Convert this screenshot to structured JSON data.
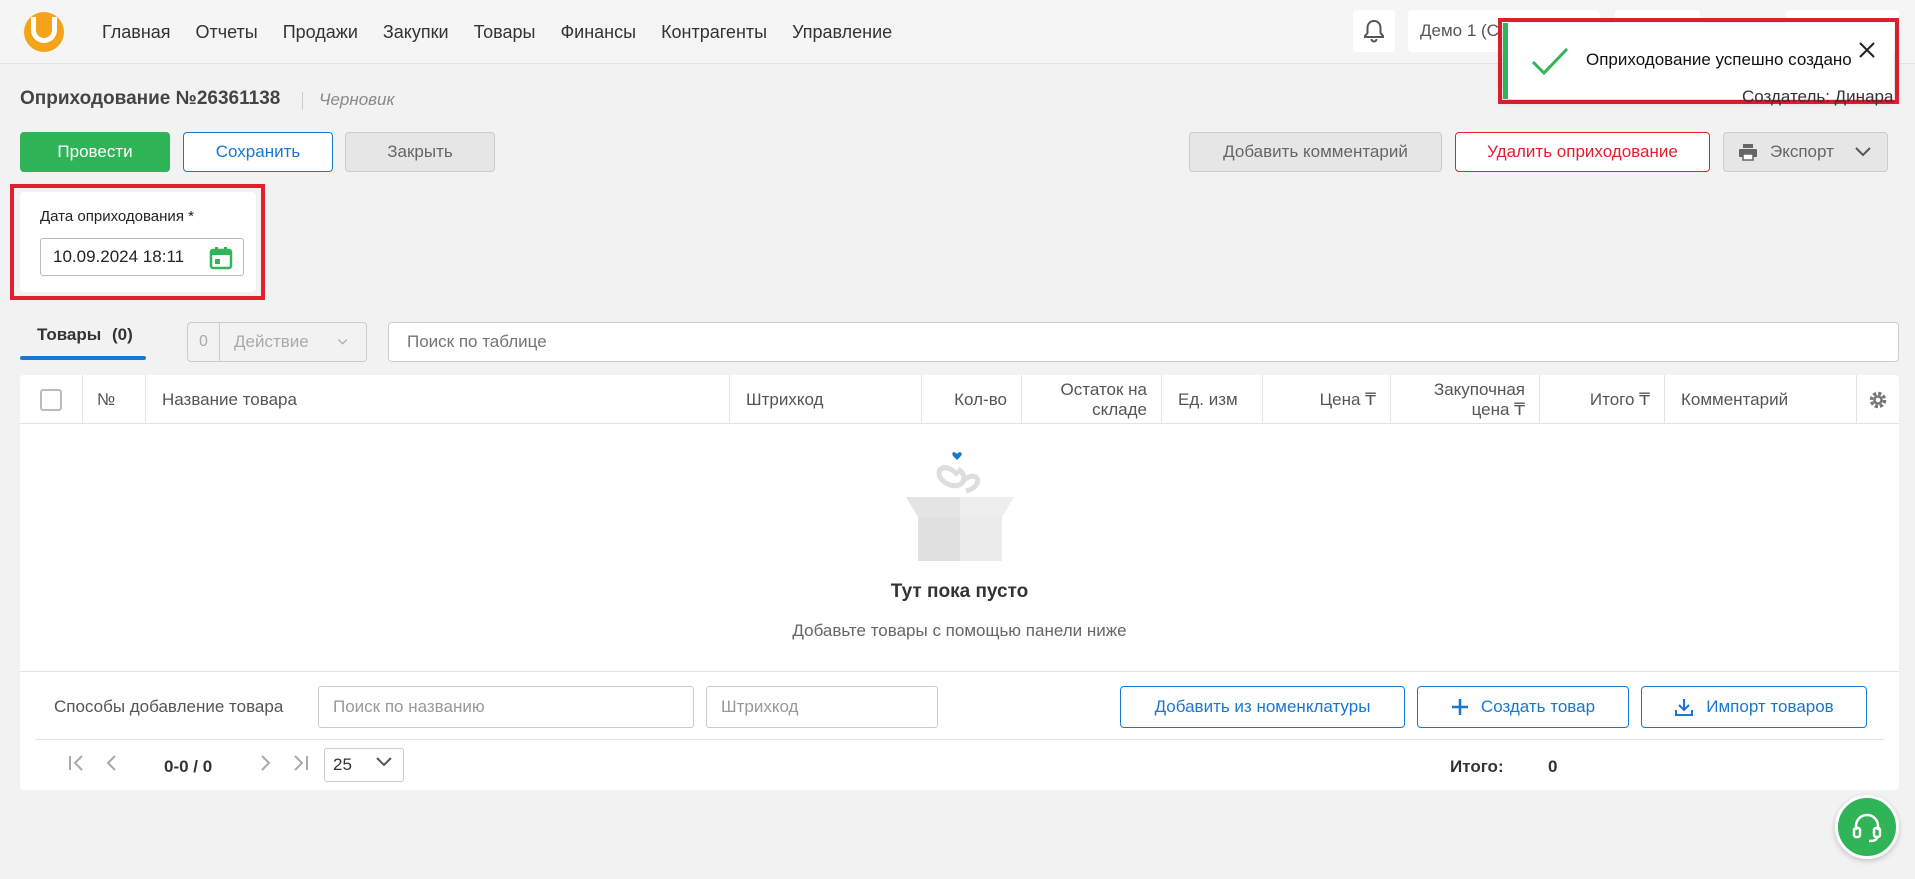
{
  "nav": {
    "items": [
      "Главная",
      "Отчеты",
      "Продажи",
      "Закупки",
      "Товары",
      "Финансы",
      "Контрагенты",
      "Управление"
    ],
    "user_label": "Демо 1 (С"
  },
  "toast": {
    "message": "Оприходование успешно создано"
  },
  "header": {
    "title": "Оприходование №26361138",
    "status": "Черновик",
    "creator": "Создатель: Динара"
  },
  "toolbar": {
    "post_label": "Провести",
    "save_label": "Сохранить",
    "close_label": "Закрыть",
    "add_comment_label": "Добавить комментарий",
    "delete_label": "Удалить оприходование",
    "export_label": "Экспорт"
  },
  "date_field": {
    "label": "Дата оприходования *",
    "value": "10.09.2024 18:11"
  },
  "tabs": {
    "goods_label": "Товары",
    "goods_count": "(0)"
  },
  "actions": {
    "selected_count": "0",
    "label": "Действие"
  },
  "search": {
    "placeholder": "Поиск по таблице"
  },
  "table": {
    "columns": {
      "num": "№",
      "name": "Название товара",
      "barcode": "Штрихкод",
      "qty": "Кол-во",
      "stock_1": "Остаток на",
      "stock_2": "складе",
      "unit": "Ед. изм",
      "price": "Цена ₸",
      "purchase_1": "Закупочная",
      "purchase_2": "цена ₸",
      "total": "Итого ₸",
      "comment": "Комментарий"
    },
    "empty_title": "Тут пока пусто",
    "empty_subtitle": "Добавьте товары с помощью панели ниже"
  },
  "add_panel": {
    "label": "Способы добавление товара",
    "name_placeholder": "Поиск по названию",
    "barcode_placeholder": "Штрихкод",
    "from_catalog_label": "Добавить из номенклатуры",
    "create_label": "Создать товар",
    "import_label": "Импорт товаров"
  },
  "pagination": {
    "range": "0-0 / 0",
    "per_page": "25",
    "total_label": "Итого:",
    "total_value": "0"
  },
  "colors": {
    "accent_green": "#2fb457",
    "accent_blue": "#1976d2",
    "danger_red": "#e0202e",
    "logo_orange": "#f5a31a"
  }
}
